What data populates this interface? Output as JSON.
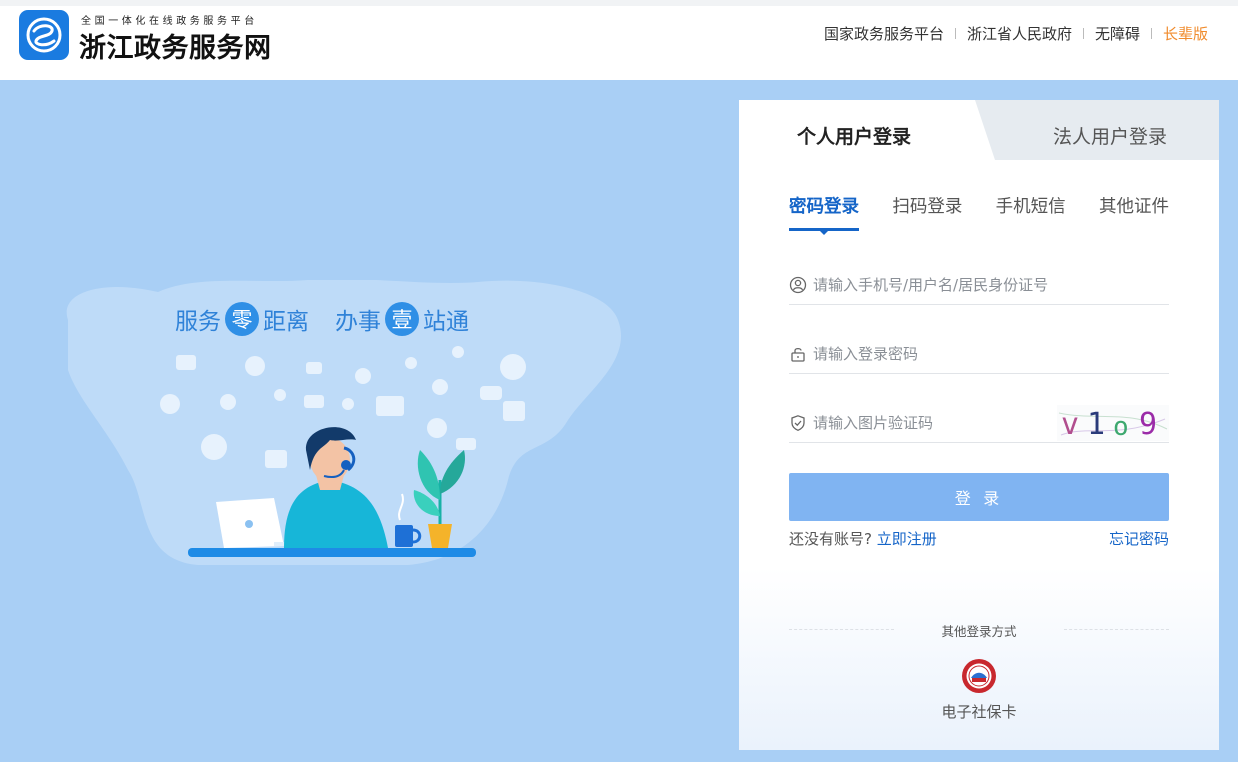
{
  "header": {
    "logo_icon": "zhejiang-gov-logo-icon",
    "logo_subtitle": "全国一体化在线政务服务平台",
    "logo_title": "浙江政务服务网",
    "nav": [
      {
        "label": "国家政务服务平台"
      },
      {
        "label": "浙江省人民政府"
      },
      {
        "label": "无障碍"
      },
      {
        "label": "长辈版"
      }
    ]
  },
  "banner": {
    "slogan": {
      "part1": "服务",
      "circle1": "零",
      "part2": "距离",
      "part3": "办事",
      "circle2": "壹",
      "part4": "站通"
    },
    "illustration_icon": "customer-service-agent-illustration"
  },
  "login": {
    "tabs": [
      {
        "label": "个人用户登录",
        "active": true
      },
      {
        "label": "法人用户登录",
        "active": false
      }
    ],
    "methods": [
      {
        "label": "密码登录",
        "active": true
      },
      {
        "label": "扫码登录",
        "active": false
      },
      {
        "label": "手机短信",
        "active": false
      },
      {
        "label": "其他证件",
        "active": false
      }
    ],
    "username_placeholder": "请输入手机号/用户名/居民身份证号",
    "password_placeholder": "请输入登录密码",
    "captcha_placeholder": "请输入图片验证码",
    "captcha_text": [
      "v",
      "1",
      "o",
      "9"
    ],
    "submit_label": "登 录",
    "no_account_text": "还没有账号?",
    "register_link": "立即注册",
    "forgot_link": "忘记密码",
    "other_methods_title": "其他登录方式",
    "social_card_label": "电子社保卡"
  },
  "colors": {
    "accent": "#1565c8",
    "banner_bg": "#a9cff5",
    "button_bg": "#80b4f2",
    "elder_link": "#f08b2c"
  }
}
